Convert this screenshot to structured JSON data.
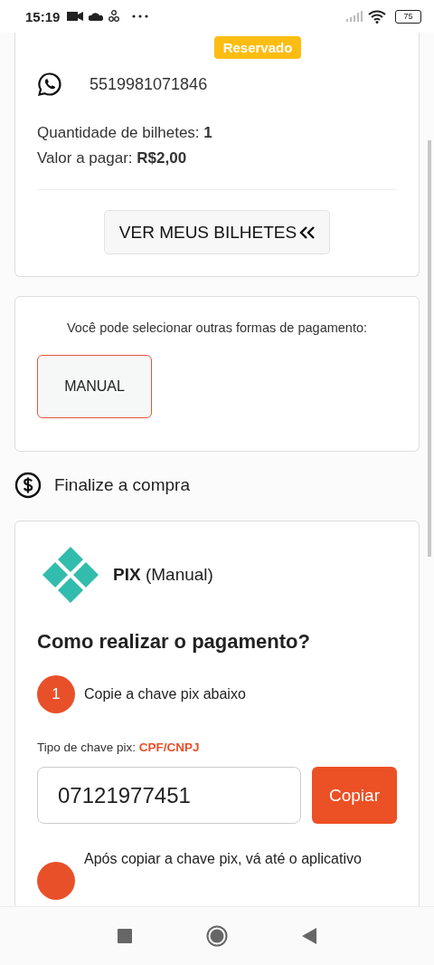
{
  "status_bar": {
    "time": "15:19",
    "battery": "75"
  },
  "ticket_card": {
    "badge": "Reservado",
    "phone": "5519981071846",
    "quantity": "Quantidade de bilhetes: **1**",
    "amount": "Valor a pagar: **R$2,00**",
    "button": "VER MEUS BILHETES"
  },
  "payment_methods": {
    "prompt": "Você pode selecionar outras formas de pagamento:",
    "options": [
      {
        "label": "MANUAL",
        "selected": true
      }
    ]
  },
  "section_title": "Finalize a compra",
  "pix": {
    "title": "**PIX** (Manual)",
    "heading": "Como realizar o pagamento?",
    "steps": [
      {
        "number": "1",
        "text": "Copie a chave pix abaixo"
      },
      {
        "text": "Após copiar a chave pix, vá até o aplicativo"
      }
    ],
    "key_type": "Tipo de chave pix: **CPF/CNPJ**",
    "key": "07121977451",
    "copy_button": "Copiar"
  }
}
